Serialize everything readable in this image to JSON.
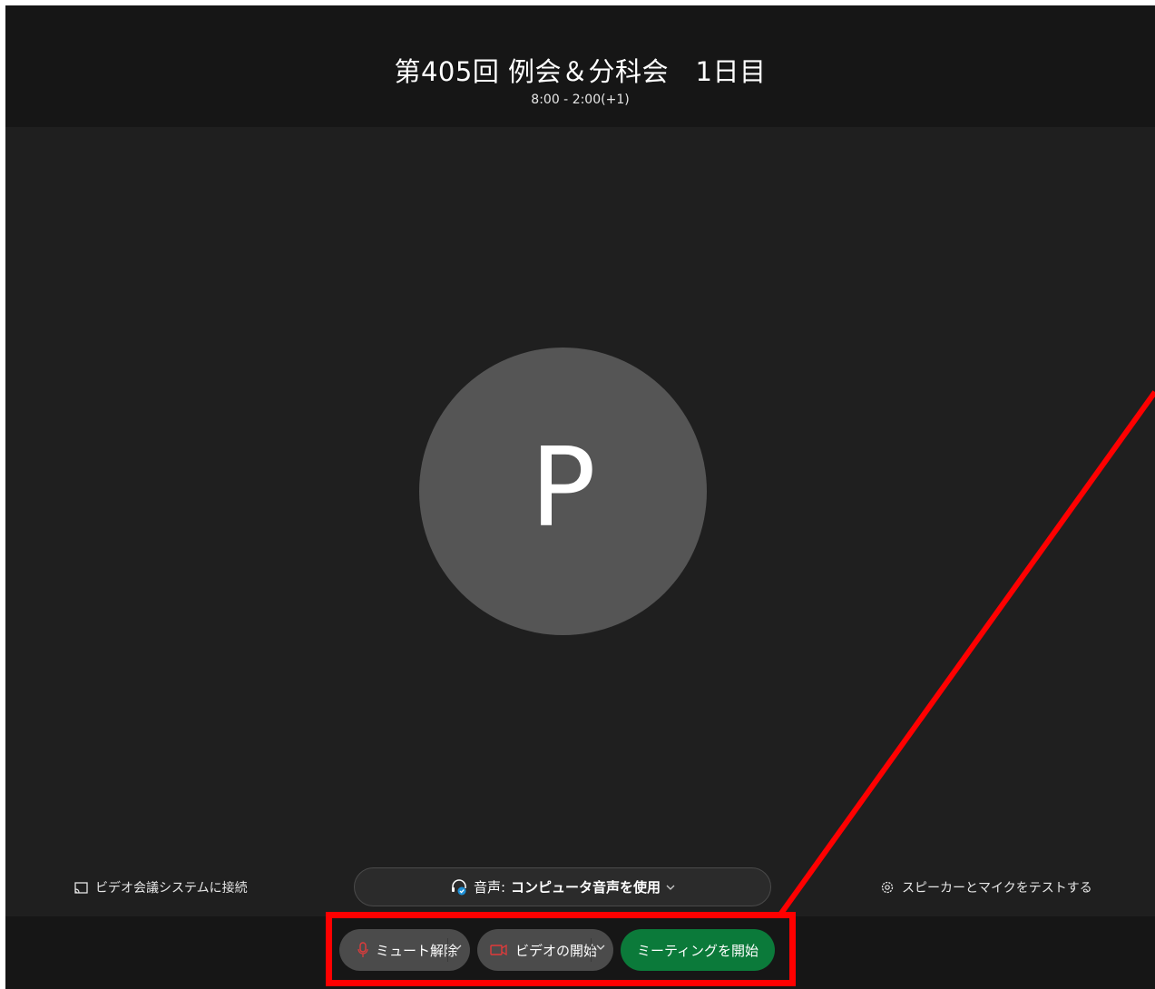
{
  "meeting": {
    "title": "第405回 例会＆分科会　1日目",
    "time": "8:00 - 2:00(+1)"
  },
  "avatar": {
    "initial": "P"
  },
  "options": {
    "video_system_link": "ビデオ会議システムに接続",
    "audio_label": "音声:",
    "audio_value": "コンピュータ音声を使用",
    "test_link": "スピーカーとマイクをテストする"
  },
  "controls": {
    "mute_label": "ミュート解除",
    "video_label": "ビデオの開始",
    "start_label": "ミーティングを開始"
  },
  "colors": {
    "background": "#1f1f1f",
    "header": "#161616",
    "avatar": "#555555",
    "start_button": "#0b7a3a",
    "control_button": "#4b4b4b",
    "icon_red": "#e23b3b",
    "annotation": "#ff0000"
  },
  "icons": {
    "video_system": "cast-icon",
    "audio": "headset-icon",
    "test": "gear-icon",
    "mute": "microphone-muted-icon",
    "video": "video-camera-off-icon",
    "caret": "chevron-down-icon"
  }
}
